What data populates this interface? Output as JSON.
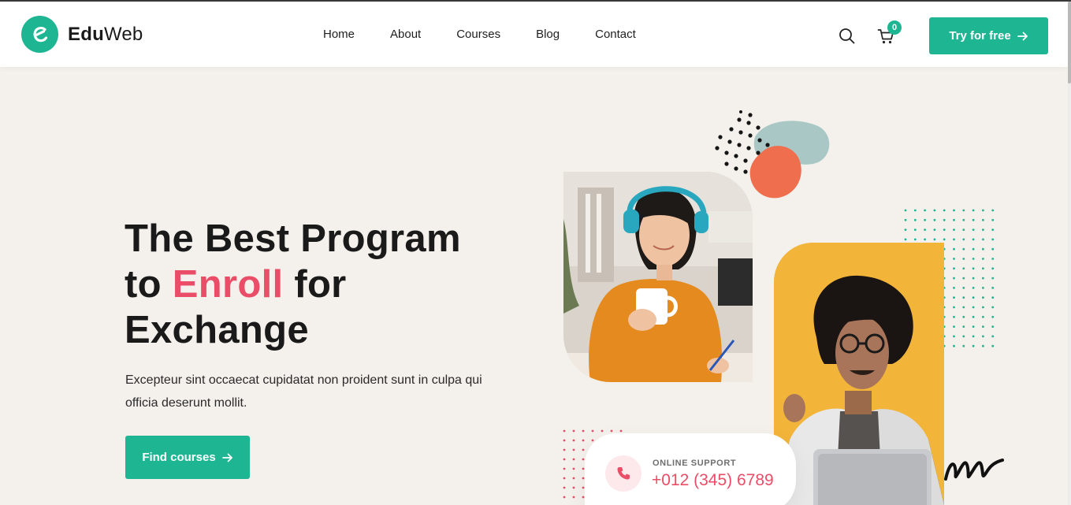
{
  "brand": {
    "name_bold": "Edu",
    "name_regular": "Web",
    "logo_icon": "e-letter-logo-icon"
  },
  "nav": {
    "items": [
      {
        "label": "Home"
      },
      {
        "label": "About"
      },
      {
        "label": "Courses"
      },
      {
        "label": "Blog"
      },
      {
        "label": "Contact"
      }
    ]
  },
  "header_actions": {
    "search_icon": "search-icon",
    "cart_icon": "cart-icon",
    "cart_count": "0",
    "try_label": "Try for free",
    "try_icon": "arrow-right-icon"
  },
  "hero": {
    "title_line1": "The Best Program",
    "title_to": "to ",
    "title_accent": "Enroll",
    "title_for": " for",
    "title_line3": "Exchange",
    "description": "Excepteur sint occaecat cupidatat non proident sunt in culpa qui officia deserunt mollit.",
    "cta_label": "Find courses",
    "cta_icon": "arrow-right-icon"
  },
  "support": {
    "label": "ONLINE SUPPORT",
    "phone": "+012 (345) 6789",
    "icon": "phone-icon"
  },
  "colors": {
    "accent": "#1eb593",
    "highlight": "#ea4d67",
    "background": "#f4f1ec",
    "photo_yellow": "#f3b43a"
  }
}
